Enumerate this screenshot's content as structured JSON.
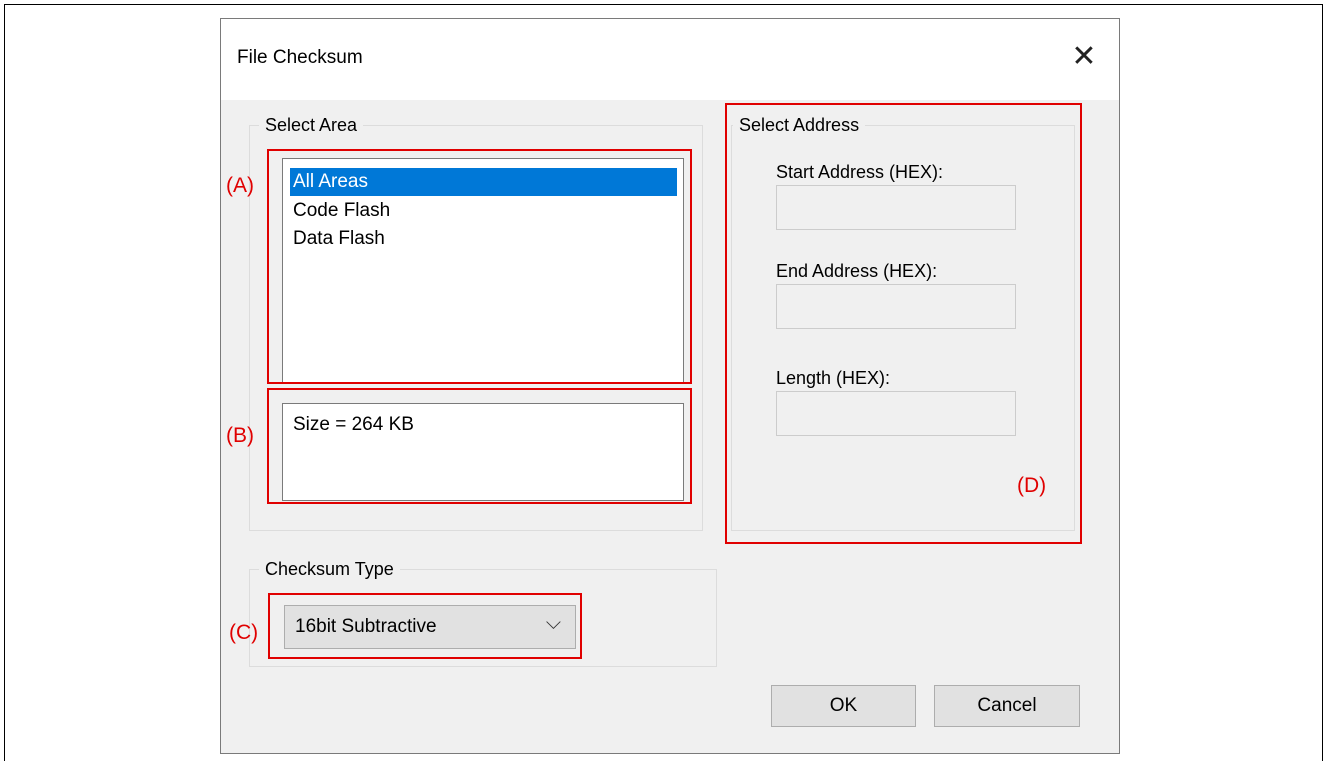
{
  "dialog": {
    "title": "File Checksum",
    "close_glyph": "✕",
    "ok_label": "OK",
    "cancel_label": "Cancel"
  },
  "select_area": {
    "label": "Select Area",
    "items": [
      "All Areas",
      "Code Flash",
      "Data Flash"
    ],
    "selected_index": 0,
    "size_text": "Size = 264 KB"
  },
  "select_address": {
    "label": "Select Address",
    "start_label": "Start Address (HEX):",
    "start_value": "",
    "end_label": "End Address (HEX):",
    "end_value": "",
    "length_label": "Length (HEX):",
    "length_value": ""
  },
  "checksum_type": {
    "label": "Checksum Type",
    "selected": "16bit Subtractive",
    "chevron_glyph": "⌵"
  },
  "annotations": {
    "a": "(A)",
    "b": "(B)",
    "c": "(C)",
    "d": "(D)",
    "color": "#e00000"
  },
  "colors": {
    "dialog_bg": "#f0f0f0",
    "selection": "#0078d7"
  }
}
